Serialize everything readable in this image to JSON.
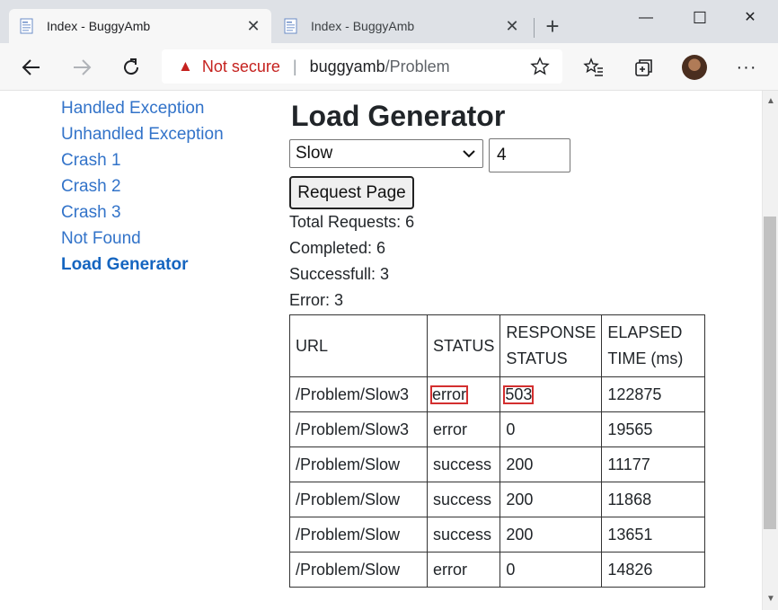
{
  "tabs": [
    {
      "title": "Index - BuggyAmb",
      "close": "✕"
    },
    {
      "title": "Index - BuggyAmb",
      "close": "✕"
    }
  ],
  "window": {
    "newtab": "+",
    "minimize": "—",
    "maximize": "☐",
    "close": "✕"
  },
  "address": {
    "warning_icon": "▲",
    "not_secure": "Not secure",
    "separator": "|",
    "host": "buggyamb",
    "path": "/Problem"
  },
  "nav": {
    "items": [
      "Handled Exception",
      "Unhandled Exception",
      "Crash 1",
      "Crash 2",
      "Crash 3",
      "Not Found",
      "Load Generator"
    ]
  },
  "main": {
    "title": "Load Generator",
    "select_value": "Slow",
    "count_value": "4",
    "button": "Request Page",
    "stats": {
      "total": "Total Requests: 6",
      "completed": "Completed: 6",
      "success": "Successfull: 3",
      "error": "Error: 3"
    }
  },
  "table": {
    "headers": [
      "URL",
      "STATUS",
      "RESPONSE STATUS",
      "ELAPSED TIME (ms)"
    ],
    "rows": [
      [
        "/Problem/Slow3",
        "error",
        "503",
        "122875"
      ],
      [
        "/Problem/Slow3",
        "error",
        "0",
        "19565"
      ],
      [
        "/Problem/Slow",
        "success",
        "200",
        "11177"
      ],
      [
        "/Problem/Slow",
        "success",
        "200",
        "11868"
      ],
      [
        "/Problem/Slow",
        "success",
        "200",
        "13651"
      ],
      [
        "/Problem/Slow",
        "error",
        "0",
        "14826"
      ]
    ]
  },
  "colors": {
    "link": "#3273c9",
    "warning": "#c5221f",
    "highlight": "#d32f2f"
  }
}
